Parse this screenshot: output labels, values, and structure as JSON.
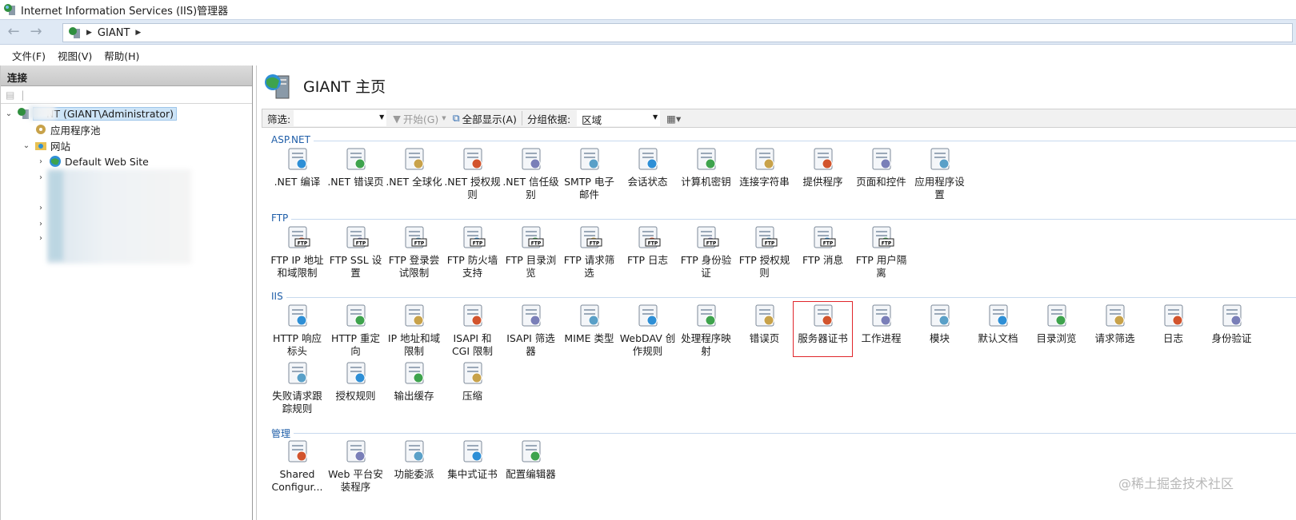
{
  "window": {
    "title": "Internet Information Services (IIS)管理器"
  },
  "address": {
    "crumb": "GIANT"
  },
  "menu": [
    "文件(F)",
    "视图(V)",
    "帮助(H)"
  ],
  "connections": {
    "header": "连接",
    "tree": [
      {
        "label": "NT (GIANT\\Administrator)",
        "level": 0,
        "expanded": true,
        "selected": true
      },
      {
        "label": "应用程序池",
        "level": 1
      },
      {
        "label": "网站",
        "level": 1,
        "expanded": true
      },
      {
        "label": "Default Web Site",
        "level": 2,
        "expanded": false
      },
      {
        "label": "n",
        "level": 2
      }
    ]
  },
  "page": {
    "title": "GIANT 主页"
  },
  "filter": {
    "label": "筛选:",
    "start": "开始(G)",
    "showall": "全部显示(A)",
    "groupby_label": "分组依据:",
    "groupby_value": "区域"
  },
  "groups": [
    {
      "name": "ASP.NET",
      "items": [
        {
          "label": ".NET 编译",
          "icon": "net-compile-icon"
        },
        {
          "label": ".NET 错误页",
          "icon": "net-error-page-icon"
        },
        {
          "label": ".NET 全球化",
          "icon": "net-globalization-icon"
        },
        {
          "label": ".NET 授权规则",
          "icon": "net-authorization-icon"
        },
        {
          "label": ".NET 信任级别",
          "icon": "net-trust-icon"
        },
        {
          "label": "SMTP 电子邮件",
          "icon": "smtp-icon"
        },
        {
          "label": "会话状态",
          "icon": "session-icon"
        },
        {
          "label": "计算机密钥",
          "icon": "machine-key-icon"
        },
        {
          "label": "连接字符串",
          "icon": "connection-string-icon"
        },
        {
          "label": "提供程序",
          "icon": "providers-icon"
        },
        {
          "label": "页面和控件",
          "icon": "pages-controls-icon"
        },
        {
          "label": "应用程序设置",
          "icon": "app-settings-icon"
        }
      ]
    },
    {
      "name": "FTP",
      "items": [
        {
          "label": "FTP IP 地址和域限制",
          "icon": "ftp-ip-icon"
        },
        {
          "label": "FTP SSL 设置",
          "icon": "ftp-ssl-icon"
        },
        {
          "label": "FTP 登录尝试限制",
          "icon": "ftp-logon-icon"
        },
        {
          "label": "FTP 防火墙支持",
          "icon": "ftp-firewall-icon"
        },
        {
          "label": "FTP 目录浏览",
          "icon": "ftp-dirbrowse-icon"
        },
        {
          "label": "FTP 请求筛选",
          "icon": "ftp-request-filter-icon"
        },
        {
          "label": "FTP 日志",
          "icon": "ftp-log-icon"
        },
        {
          "label": "FTP 身份验证",
          "icon": "ftp-auth-icon"
        },
        {
          "label": "FTP 授权规则",
          "icon": "ftp-authz-icon"
        },
        {
          "label": "FTP 消息",
          "icon": "ftp-message-icon"
        },
        {
          "label": "FTP 用户隔离",
          "icon": "ftp-isolation-icon"
        }
      ]
    },
    {
      "name": "IIS",
      "items": [
        {
          "label": "HTTP 响应标头",
          "icon": "http-headers-icon"
        },
        {
          "label": "HTTP 重定向",
          "icon": "http-redirect-icon"
        },
        {
          "label": "IP 地址和域限制",
          "icon": "ip-restrict-icon"
        },
        {
          "label": "ISAPI 和 CGI 限制",
          "icon": "isapi-cgi-icon"
        },
        {
          "label": "ISAPI 筛选器",
          "icon": "isapi-filter-icon"
        },
        {
          "label": "MIME 类型",
          "icon": "mime-icon"
        },
        {
          "label": "WebDAV 创作规则",
          "icon": "webdav-icon"
        },
        {
          "label": "处理程序映射",
          "icon": "handler-icon"
        },
        {
          "label": "错误页",
          "icon": "error-page-icon"
        },
        {
          "label": "服务器证书",
          "icon": "server-cert-icon"
        },
        {
          "label": "工作进程",
          "icon": "worker-process-icon"
        },
        {
          "label": "模块",
          "icon": "modules-icon"
        },
        {
          "label": "默认文档",
          "icon": "default-doc-icon"
        },
        {
          "label": "目录浏览",
          "icon": "dir-browse-icon"
        },
        {
          "label": "请求筛选",
          "icon": "request-filter-icon"
        },
        {
          "label": "日志",
          "icon": "logging-icon"
        },
        {
          "label": "身份验证",
          "icon": "authentication-icon"
        },
        {
          "label": "失败请求跟踪规则",
          "icon": "failed-request-icon"
        },
        {
          "label": "授权规则",
          "icon": "authz-rules-icon"
        },
        {
          "label": "输出缓存",
          "icon": "output-cache-icon"
        },
        {
          "label": "压缩",
          "icon": "compression-icon"
        }
      ]
    },
    {
      "name": "管理",
      "items": [
        {
          "label": "Shared Configur...",
          "icon": "shared-config-icon"
        },
        {
          "label": "Web 平台安装程序",
          "icon": "web-platform-icon"
        },
        {
          "label": "功能委派",
          "icon": "feature-delegation-icon"
        },
        {
          "label": "集中式证书",
          "icon": "central-cert-icon"
        },
        {
          "label": "配置编辑器",
          "icon": "config-editor-icon"
        }
      ]
    }
  ],
  "highlighted": "服务器证书",
  "watermark": "@稀土掘金技术社区",
  "colors": {
    "accent": "#1f5ea8",
    "highlight": "#e0262b",
    "selection": "#cde4f7"
  }
}
